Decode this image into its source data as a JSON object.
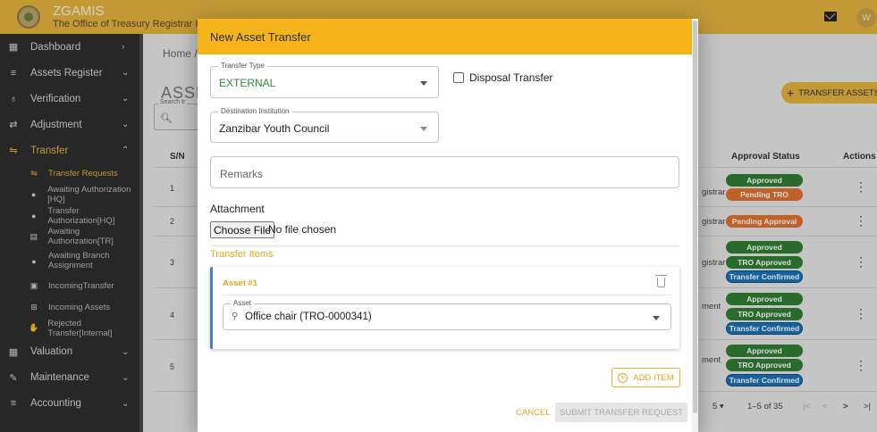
{
  "app": {
    "name": "ZGAMIS",
    "subtitle": "The Office of Treasury Registrar HQ",
    "avatar_initial": "W",
    "icons": {
      "mail": "mail-icon",
      "logo": "emblem-logo"
    }
  },
  "sidebar": {
    "items": [
      {
        "label": "Dashboard",
        "icon": "dashboard-icon",
        "chevron": "›"
      },
      {
        "label": "Assets Register",
        "icon": "list-icon",
        "chevron": "⌄"
      },
      {
        "label": "Verification",
        "icon": "badge-icon",
        "chevron": "⌄"
      },
      {
        "label": "Adjustment",
        "icon": "swap-icon",
        "chevron": "⌄"
      },
      {
        "label": "Transfer",
        "icon": "transfer-icon",
        "chevron": "⌃"
      }
    ],
    "transfer_sub": [
      {
        "label": "Transfer Requests",
        "icon": "transfer-icon"
      },
      {
        "label": "Awaiting Authorization [HQ]",
        "icon": "dots-icon"
      },
      {
        "label": "Transfer Authorization[HQ]",
        "icon": "dots-icon"
      },
      {
        "label": "Awaiting Authorization[TR]",
        "icon": "doc-icon"
      },
      {
        "label_l1": "Awaiting Branch",
        "label_l2": "Assignment",
        "icon": "dots-icon"
      },
      {
        "label": "IncomingTransfer",
        "icon": "inbox-icon"
      },
      {
        "label": "Incoming Assets",
        "icon": "plus-box-icon"
      },
      {
        "label": "Rejected Transfer[Internal]",
        "icon": "thumb-down-icon"
      }
    ],
    "bottom_items": [
      {
        "label": "Valuation",
        "icon": "calc-icon",
        "chevron": "⌄"
      },
      {
        "label": "Maintenance",
        "icon": "wrench-icon",
        "chevron": "⌄"
      },
      {
        "label": "Accounting",
        "icon": "list-icon",
        "chevron": "⌄"
      }
    ]
  },
  "page": {
    "breadcrumb": "Home /",
    "title_partial": "ASSE",
    "search_label": "Search tr",
    "transfer_assets_button": "TRANSFER ASSETS",
    "columns": {
      "sn": "S/N",
      "approval": "Approval Status",
      "actions": "Actions"
    },
    "rows": [
      {
        "sn": "1",
        "partial": "gistrar",
        "statuses": [
          {
            "text": "Approved",
            "color": "#2f7d32"
          },
          {
            "text": "Pending TRO",
            "color": "#e0712f"
          }
        ]
      },
      {
        "sn": "2",
        "partial": "gistrar",
        "statuses": [
          {
            "text": "Pending Approval",
            "color": "#e0712f"
          }
        ]
      },
      {
        "sn": "3",
        "partial": "gistrar",
        "statuses": [
          {
            "text": "Approved",
            "color": "#2f7d32"
          },
          {
            "text": "TRO Approved",
            "color": "#2f7d32"
          },
          {
            "text": "Transfer Confirmed",
            "color": "#1a73b8"
          }
        ]
      },
      {
        "sn": "4",
        "partial": "ment",
        "statuses": [
          {
            "text": "Approved",
            "color": "#2f7d32"
          },
          {
            "text": "TRO Approved",
            "color": "#2f7d32"
          },
          {
            "text": "Transfer Confirmed",
            "color": "#1a73b8"
          }
        ]
      },
      {
        "sn": "5",
        "partial": "ment",
        "statuses": [
          {
            "text": "Approved",
            "color": "#2f7d32"
          },
          {
            "text": "TRO Approved",
            "color": "#2f7d32"
          },
          {
            "text": "Transfer Confirmed",
            "color": "#1a73b8"
          }
        ]
      }
    ],
    "pagination": {
      "rows_per_page": "5",
      "range": "1–5 of 35"
    }
  },
  "modal": {
    "title": "New Asset Transfer",
    "transfer_type": {
      "label": "Transfer Type",
      "value": "EXTERNAL"
    },
    "disposal_transfer": {
      "label": "Disposal Transfer",
      "checked": false
    },
    "destination": {
      "label": "Destination Institution",
      "value": "Zanzibar Youth Council"
    },
    "remarks": {
      "placeholder": "Remarks"
    },
    "attachment": {
      "label": "Attachment",
      "button": "Choose File",
      "status": "No file chosen"
    },
    "items_title": "Transfer Items",
    "asset_card": {
      "title": "Asset #1",
      "field_label": "Asset",
      "value": "Office chair (TRO-0000341)"
    },
    "add_item": "ADD ITEM",
    "cancel": "CANCEL",
    "submit": "SUBMIT TRANSFER REQUEST"
  },
  "colors": {
    "accent": "#f4b41a",
    "sidebar": "#2e2e2e",
    "link": "#e2a81e",
    "external": "#2e8b3a"
  }
}
